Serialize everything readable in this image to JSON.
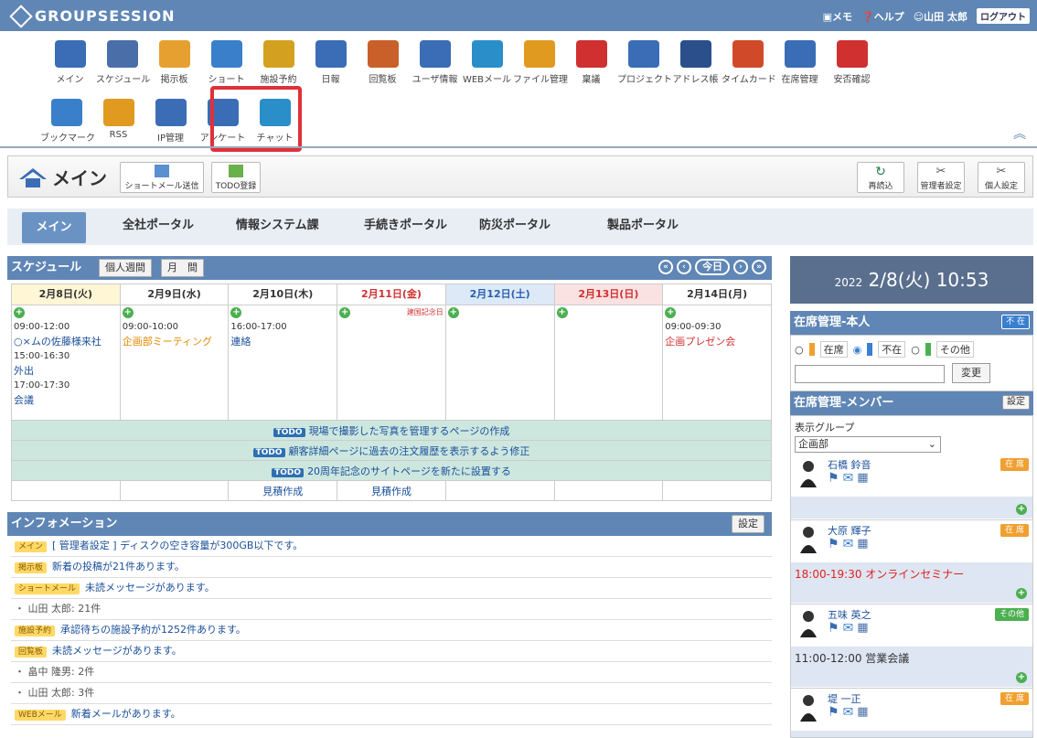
{
  "header": {
    "logo": "GROUPSESSION",
    "links": {
      "memo": "メモ",
      "help": "ヘルプ",
      "user": "山田 太郎",
      "logout": "ログアウト"
    }
  },
  "apps_row1": [
    {
      "label": "メイン",
      "icon": "house-icon",
      "color": "#3a6db5"
    },
    {
      "label": "スケジュール",
      "icon": "calendar-icon",
      "color": "#4a6fa8"
    },
    {
      "label": "掲示板",
      "icon": "bulletin-icon",
      "color": "#e6a030"
    },
    {
      "label": "ショート",
      "icon": "mail-icon",
      "color": "#3a7fc9"
    },
    {
      "label": "施設予約",
      "icon": "facility-icon",
      "color": "#d4a020"
    },
    {
      "label": "日報",
      "icon": "report-icon",
      "color": "#3a6db5"
    },
    {
      "label": "回覧板",
      "icon": "circular-icon",
      "color": "#c9602a"
    },
    {
      "label": "ユーザ情報",
      "icon": "user-icon",
      "color": "#3a6db5"
    },
    {
      "label": "WEBメール",
      "icon": "globe-icon",
      "color": "#2a8fc9"
    },
    {
      "label": "ファイル管理",
      "icon": "folder-icon",
      "color": "#e09a20"
    },
    {
      "label": "稟議",
      "icon": "approval-icon",
      "color": "#d03030"
    },
    {
      "label": "プロジェクト",
      "icon": "project-icon",
      "color": "#3a6db5"
    },
    {
      "label": "アドレス帳",
      "icon": "address-icon",
      "color": "#2a4f8a"
    },
    {
      "label": "タイムカード",
      "icon": "clock-icon",
      "color": "#d04a2a"
    },
    {
      "label": "在席管理",
      "icon": "presence-icon",
      "color": "#3a6db5"
    },
    {
      "label": "安否確認",
      "icon": "alert-icon",
      "color": "#d03030"
    }
  ],
  "apps_row2": [
    {
      "label": "ブックマーク",
      "icon": "bookmark-icon",
      "color": "#3a7fc9"
    },
    {
      "label": "RSS",
      "icon": "rss-icon",
      "color": "#e09a20"
    },
    {
      "label": "IP管理",
      "icon": "ip-icon",
      "color": "#3a6db5"
    },
    {
      "label": "アンケート",
      "icon": "survey-icon",
      "color": "#3a6db5"
    },
    {
      "label": "チャット",
      "icon": "chat-icon",
      "color": "#2a8fc9"
    }
  ],
  "main": {
    "title": "メイン",
    "btn_shortmail": "ショートメール送信",
    "btn_todo": "TODO登録",
    "btn_reload": "再読込",
    "btn_admin": "管理者設定",
    "btn_personal": "個人設定"
  },
  "tabs": [
    "メイン",
    "全社ポータル",
    "情報システム課",
    "手続きポータル",
    "防災ポータル",
    "製品ポータル"
  ],
  "schedule": {
    "title": "スケジュール",
    "btn_week": "個人週間",
    "btn_month": "月　間",
    "today": "今日",
    "days": [
      {
        "label": "2月8日(火)",
        "type": "today"
      },
      {
        "label": "2月9日(水)",
        "type": "normal"
      },
      {
        "label": "2月10日(木)",
        "type": "normal"
      },
      {
        "label": "2月11日(金)",
        "type": "holiday"
      },
      {
        "label": "2月12日(土)",
        "type": "sat"
      },
      {
        "label": "2月13日(日)",
        "type": "sun"
      },
      {
        "label": "2月14日(月)",
        "type": "normal"
      }
    ],
    "holiday_note": "建国記念日",
    "events": {
      "d0": [
        {
          "time": "09:00-12:00",
          "title": "○×ムの佐藤様来社"
        },
        {
          "time": "15:00-16:30",
          "title": "外出"
        },
        {
          "time": "17:00-17:30",
          "title": "会議"
        }
      ],
      "d1": [
        {
          "time": "09:00-10:00",
          "title": "企画部ミーティング"
        }
      ],
      "d2": [
        {
          "time": "16:00-17:00",
          "title": "連絡"
        }
      ],
      "d6": [
        {
          "time": "09:00-09:30",
          "title": "企画プレゼン会"
        }
      ]
    },
    "todos": [
      "現場で撮影した写真を管理するページの作成",
      "顧客詳細ページに過去の注文履歴を表示するよう修正",
      "20周年記念のサイトページを新たに設置する"
    ],
    "todo_tag": "TODO",
    "bottom": {
      "d2": "見積作成",
      "d3": "見積作成"
    }
  },
  "info": {
    "title": "インフォメーション",
    "btn": "設定",
    "rows": [
      {
        "tag": "メイン",
        "text": "[ 管理者設定 ] ディスクの空き容量が300GB以下です。"
      },
      {
        "tag": "掲示板",
        "text": "新着の投稿が21件あります。"
      },
      {
        "tag": "ショートメール",
        "text": "未読メッセージがあります。"
      },
      {
        "tag": "",
        "text": "・ 山田 太郎: 21件"
      },
      {
        "tag": "施設予約",
        "text": "承認待ちの施設予約が1252件あります。"
      },
      {
        "tag": "回覧板",
        "text": "未読メッセージがあります。"
      },
      {
        "tag": "",
        "text": "・ 畠中 隆男: 2件"
      },
      {
        "tag": "",
        "text": "・ 山田 太郎: 3件"
      },
      {
        "tag": "WEBメール",
        "text": "新着メールがあります。"
      }
    ]
  },
  "clock": {
    "year": "2022",
    "date": "2/8(火) 10:53"
  },
  "presence": {
    "title": "在席管理-本人",
    "badge": "不 在",
    "opt_in": "在席",
    "opt_out": "不在",
    "opt_other": "その他",
    "btn_change": "変更"
  },
  "members": {
    "title": "在席管理-メンバー",
    "btn": "設定",
    "group_label": "表示グループ",
    "group_value": "企画部",
    "list": [
      {
        "name": "石橋 鈴音",
        "status": "在 席",
        "color": "#f0a030",
        "sched": ""
      },
      {
        "name": "大原 輝子",
        "status": "在 席",
        "color": "#f0a030",
        "sched": "18:00-19:30  オンラインセミナー"
      },
      {
        "name": "五味 英之",
        "status": "その他",
        "color": "#4caf50",
        "sched": "11:00-12:00  営業会議"
      },
      {
        "name": "堤 一正",
        "status": "在 席",
        "color": "#f0a030",
        "sched": ""
      }
    ]
  }
}
